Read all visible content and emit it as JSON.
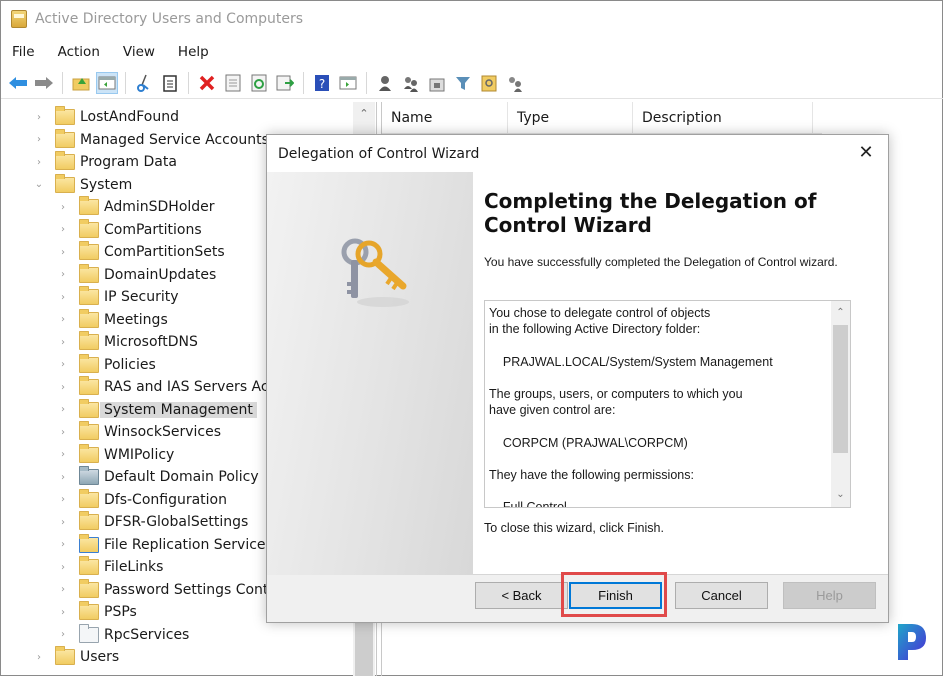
{
  "window": {
    "title": "Active Directory Users and Computers"
  },
  "menubar": {
    "items": [
      "File",
      "Action",
      "View",
      "Help"
    ]
  },
  "toolbar": {
    "buttons": [
      "back-arrow-icon",
      "forward-arrow-icon",
      "up-folder-icon",
      "show-console-tree-icon",
      "cut-icon",
      "copy-icon",
      "delete-icon",
      "properties-icon",
      "refresh-icon",
      "export-list-icon",
      "help-icon",
      "show-action-pane-icon",
      "new-user-icon",
      "new-group-icon",
      "new-ou-icon",
      "filter-icon",
      "find-icon",
      "add-to-group-icon"
    ]
  },
  "tree": {
    "items": [
      {
        "label": "LostAndFound",
        "level": 1,
        "expanded": false,
        "icon": "folder"
      },
      {
        "label": "Managed Service Accounts",
        "level": 1,
        "expanded": false,
        "icon": "folder"
      },
      {
        "label": "Program Data",
        "level": 1,
        "expanded": false,
        "icon": "folder"
      },
      {
        "label": "System",
        "level": 1,
        "expanded": true,
        "icon": "folder"
      },
      {
        "label": "AdminSDHolder",
        "level": 2,
        "icon": "folder"
      },
      {
        "label": "ComPartitions",
        "level": 2,
        "icon": "folder"
      },
      {
        "label": "ComPartitionSets",
        "level": 2,
        "icon": "folder"
      },
      {
        "label": "DomainUpdates",
        "level": 2,
        "icon": "folder"
      },
      {
        "label": "IP Security",
        "level": 2,
        "icon": "folder"
      },
      {
        "label": "Meetings",
        "level": 2,
        "icon": "folder"
      },
      {
        "label": "MicrosoftDNS",
        "level": 2,
        "icon": "folder"
      },
      {
        "label": "Policies",
        "level": 2,
        "icon": "folder"
      },
      {
        "label": "RAS and IAS Servers Acces",
        "level": 2,
        "icon": "folder"
      },
      {
        "label": "System Management",
        "level": 2,
        "icon": "folder",
        "selected": true
      },
      {
        "label": "WinsockServices",
        "level": 2,
        "icon": "folder"
      },
      {
        "label": "WMIPolicy",
        "level": 2,
        "icon": "folder"
      },
      {
        "label": "Default Domain Policy",
        "level": 2,
        "icon": "policy"
      },
      {
        "label": "Dfs-Configuration",
        "level": 2,
        "icon": "folder"
      },
      {
        "label": "DFSR-GlobalSettings",
        "level": 2,
        "icon": "folder"
      },
      {
        "label": "File Replication Service",
        "level": 2,
        "icon": "repl"
      },
      {
        "label": "FileLinks",
        "level": 2,
        "icon": "folder"
      },
      {
        "label": "Password Settings Contai",
        "level": 2,
        "icon": "folder"
      },
      {
        "label": "PSPs",
        "level": 2,
        "icon": "folder"
      },
      {
        "label": "RpcServices",
        "level": 2,
        "icon": "rpc"
      },
      {
        "label": "Users",
        "level": 1,
        "expanded": false,
        "icon": "folder"
      }
    ]
  },
  "list": {
    "columns": [
      "Name",
      "Type",
      "Description"
    ]
  },
  "dialog": {
    "title": "Delegation of Control Wizard",
    "heading": "Completing the Delegation of Control Wizard",
    "message": "You have successfully completed the Delegation of Control wizard.",
    "summary": "You chose to delegate control of objects\nin the following Active Directory folder:\n\n    PRAJWAL.LOCAL/System/System Management\n\nThe groups, users, or computers to which you\nhave given control are:\n\n    CORPCM (PRAJWAL\\CORPCM)\n\nThey have the following permissions:\n\n    Full Control",
    "footer_message": "To close this wizard, click Finish.",
    "buttons": {
      "back": "< Back",
      "finish": "Finish",
      "cancel": "Cancel",
      "help": "Help"
    }
  },
  "colors": {
    "highlight": "#e04a4a",
    "primary_border": "#0078d7"
  }
}
